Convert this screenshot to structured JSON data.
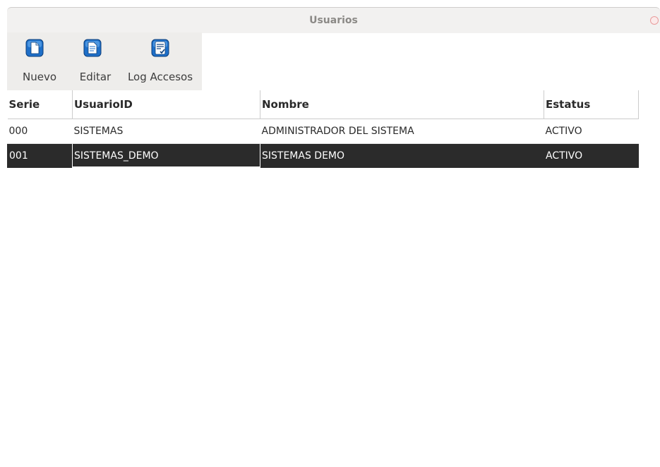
{
  "window": {
    "title": "Usuarios"
  },
  "toolbar": {
    "items": [
      {
        "label": "Nuevo",
        "icon": "new-document-icon"
      },
      {
        "label": "Editar",
        "icon": "edit-document-icon"
      },
      {
        "label": "Log Accesos",
        "icon": "access-log-icon"
      }
    ]
  },
  "table": {
    "columns": [
      "Serie",
      "UsuarioID",
      "Nombre",
      "Estatus"
    ],
    "rows": [
      [
        "000",
        "SISTEMAS",
        "ADMINISTRADOR DEL SISTEMA",
        "ACTIVO"
      ],
      [
        "001",
        "SISTEMAS_DEMO",
        "SISTEMAS DEMO",
        "ACTIVO"
      ]
    ],
    "selected_row": 1
  },
  "colors": {
    "selection_bg": "#2b2b2b",
    "icon_blue": "#1e6fc8",
    "close_button": "#e89c9c"
  }
}
